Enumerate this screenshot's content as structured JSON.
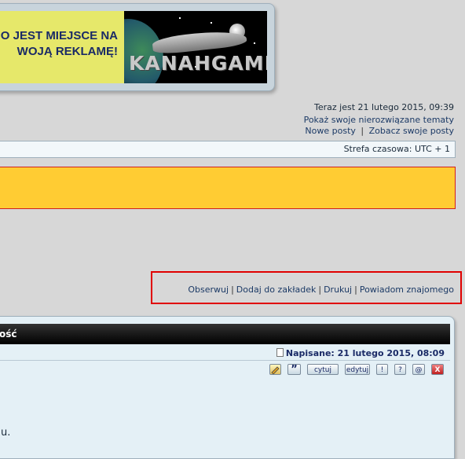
{
  "banner": {
    "ad_line1": "O JEST MIEJSCE NA",
    "ad_line2": "WOJĄ REKLAMĘ!",
    "logo_text": "KANAHGAME"
  },
  "info": {
    "current_time": "Teraz jest 21 lutego 2015, 09:39",
    "unanswered_link": "Pokaż swoje nierozwiązane tematy",
    "new_posts_link": "Nowe posty",
    "separator": "|",
    "own_posts_link": "Zobacz swoje posty"
  },
  "timezone": "Strefa czasowa: UTC + 1",
  "topic_actions": {
    "watch": "Obserwuj",
    "bookmark": "Dodaj do zakładek",
    "print": "Drukuj",
    "notify": "Powiadom znajomego",
    "separator": "|"
  },
  "post": {
    "header": "ość",
    "posted": "Napisane: 21 lutego 2015, 08:09",
    "body_fragment": "u.",
    "buttons": {
      "quote_mark": "”",
      "quote": "cytuj",
      "edit": "edytuj",
      "report": "!",
      "info": "?",
      "warn": "@",
      "delete": "X"
    }
  },
  "colors": {
    "highlight_border": "#e00000",
    "notice_bar": "#ffcc33",
    "header_bg": "#000000"
  }
}
